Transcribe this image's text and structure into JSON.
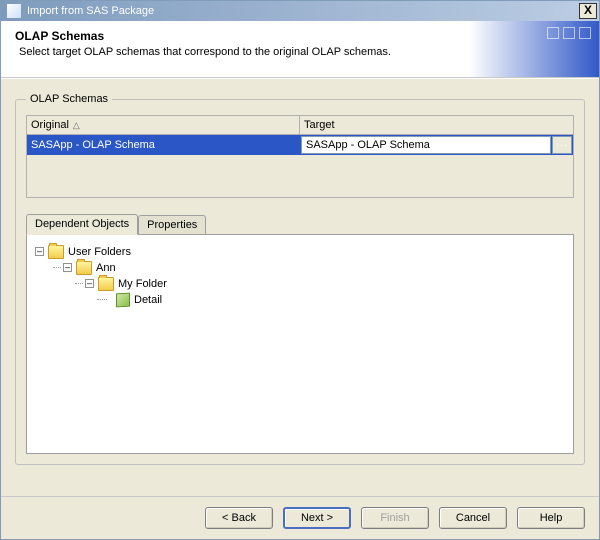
{
  "titlebar": {
    "title": "Import from SAS Package",
    "close_label": "X"
  },
  "header": {
    "title": "OLAP Schemas",
    "subtitle": "Select target OLAP schemas that correspond to the original OLAP schemas."
  },
  "groupbox": {
    "legend": "OLAP Schemas"
  },
  "table": {
    "col_original": "Original",
    "col_target": "Target",
    "sort_indicator": "△",
    "rows": [
      {
        "original": "SASApp - OLAP Schema",
        "target": "SASApp - OLAP Schema"
      }
    ],
    "browse_label": "..."
  },
  "tabs": {
    "dependent": "Dependent Objects",
    "properties": "Properties"
  },
  "tree": {
    "expander_open": "–",
    "root": "User Folders",
    "l1": "Ann",
    "l2": "My Folder",
    "leaf": "Detail"
  },
  "buttons": {
    "back": "< Back",
    "next": "Next >",
    "finish": "Finish",
    "cancel": "Cancel",
    "help": "Help"
  }
}
